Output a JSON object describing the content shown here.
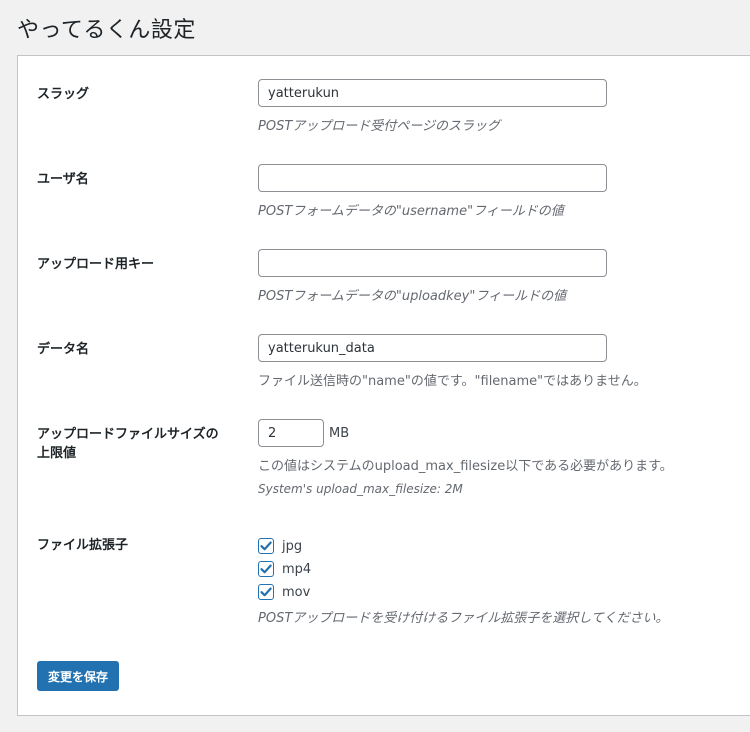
{
  "page": {
    "title": "やってるくん設定"
  },
  "fields": {
    "slug": {
      "label": "スラッグ",
      "value": "yatterukun",
      "description": "POSTアップロード受付ページのスラッグ"
    },
    "username": {
      "label": "ユーザ名",
      "value": "",
      "description": "POSTフォームデータの\"username\"フィールドの値"
    },
    "upload_key": {
      "label": "アップロード用キー",
      "value": "",
      "description": "POSTフォームデータの\"uploadkey\"フィールドの値"
    },
    "data_name": {
      "label": "データ名",
      "value": "yatterukun_data",
      "description": "ファイル送信時の\"name\"の値です。\"filename\"ではありません。"
    },
    "max_size": {
      "label_line1": "アップロードファイルサイズの",
      "label_line2": "上限値",
      "value": "2",
      "unit": "MB",
      "description": "この値はシステムのupload_max_filesize以下である必要があります。",
      "note": "System's upload_max_filesize: 2M"
    },
    "extensions": {
      "label": "ファイル拡張子",
      "options": [
        {
          "label": "jpg",
          "checked": true
        },
        {
          "label": "mp4",
          "checked": true
        },
        {
          "label": "mov",
          "checked": true
        }
      ],
      "description": "POSTアップロードを受け付けるファイル拡張子を選択してください。"
    }
  },
  "actions": {
    "save_label": "変更を保存"
  },
  "colors": {
    "accent": "#2271b1",
    "background": "#f1f1f1",
    "panel": "#ffffff"
  }
}
